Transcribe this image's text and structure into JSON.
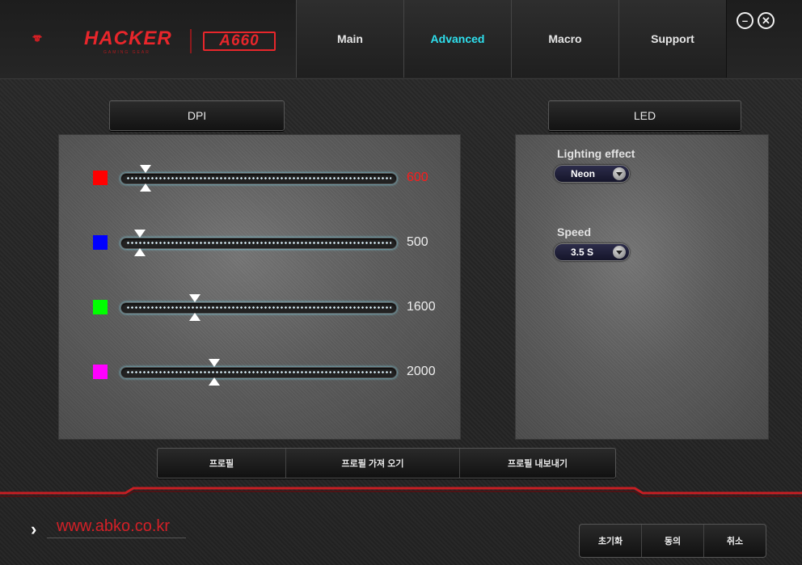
{
  "brand": {
    "name": "HACKER",
    "subtitle": "GAMING GEAR",
    "model": "A660"
  },
  "tabs": [
    {
      "label": "Main"
    },
    {
      "label": "Advanced",
      "active": true
    },
    {
      "label": "Macro"
    },
    {
      "label": "Support"
    }
  ],
  "window": {
    "minimize_icon": "minimize-icon",
    "close_icon": "close-icon"
  },
  "dpi": {
    "header": "DPI",
    "rows": [
      {
        "color": "#ff0000",
        "value": "600",
        "value_color": "#ff1a1a",
        "level": 0.09
      },
      {
        "color": "#0000ff",
        "value": "500",
        "value_color": "#eeeeee",
        "level": 0.07
      },
      {
        "color": "#00ff00",
        "value": "1600",
        "value_color": "#eeeeee",
        "level": 0.27
      },
      {
        "color": "#ff00ff",
        "value": "2000",
        "value_color": "#eeeeee",
        "level": 0.34
      }
    ]
  },
  "led": {
    "header": "LED",
    "lighting_label": "Lighting effect",
    "lighting_value": "Neon",
    "speed_label": "Speed",
    "speed_value": "3.5 S"
  },
  "profile": {
    "buttons": [
      "프로필",
      "프로필 가져 오기",
      "프로필 내보내기"
    ]
  },
  "footer": {
    "url": "www.abko.co.kr",
    "buttons": [
      "초기화",
      "동의",
      "취소"
    ]
  },
  "colors": {
    "accent_red": "#e8262b",
    "active_tab": "#2ee0ee"
  }
}
